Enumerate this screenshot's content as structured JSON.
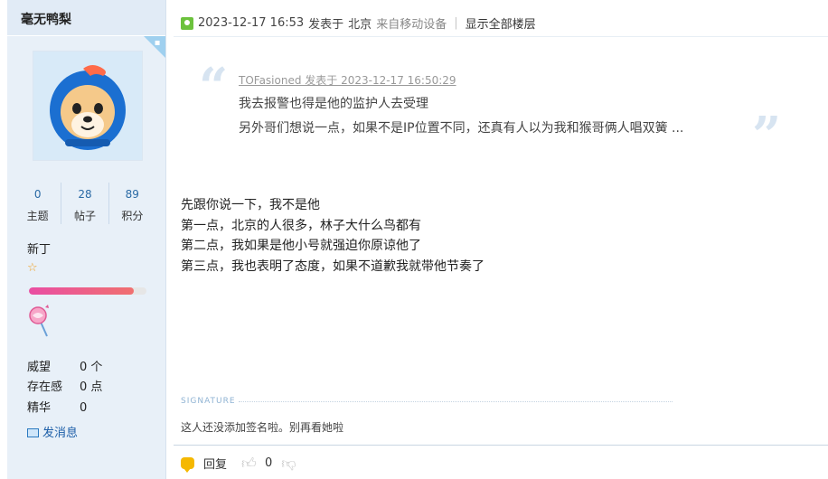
{
  "profile": {
    "username": "毫无鸭梨",
    "stats": [
      {
        "value": "0",
        "label": "主题"
      },
      {
        "value": "28",
        "label": "帖子"
      },
      {
        "value": "89",
        "label": "积分"
      }
    ],
    "rank": "新丁",
    "progress_fraction": 0.89,
    "weiwang_label": "威望",
    "weiwang_value": "0 个",
    "cunzai_label": "存在感",
    "cunzai_value": "0 点",
    "jinghua_label": "精华",
    "jinghua_value": "0",
    "send_message": "发消息",
    "colors": {
      "accent": "#1c5ea8",
      "bar": "#e94ea3"
    }
  },
  "post": {
    "timestamp": "2023-12-17 16:53",
    "posted_at": "发表于",
    "location": "北京",
    "device": "来自移动设备",
    "show_all": "显示全部楼层",
    "quote": {
      "author_line": "TOFasioned 发表于 2023-12-17 16:50:29",
      "line1": "我去报警也得是他的监护人去受理",
      "line2": "另外哥们想说一点，如果不是IP位置不同，还真有人以为我和猴哥俩人唱双簧 ..."
    },
    "body": [
      "先跟你说一下，我不是他",
      "第一点，北京的人很多，林子大什么鸟都有",
      "第二点，我如果是他小号就强迫你原谅他了",
      "第三点，我也表明了态度，如果不道歉我就带他节奏了"
    ],
    "signature_label": "SIGNATURE",
    "signature_text": "这人还没添加签名啦。别再看她啦",
    "reply_label": "回复",
    "like_count": "0"
  }
}
